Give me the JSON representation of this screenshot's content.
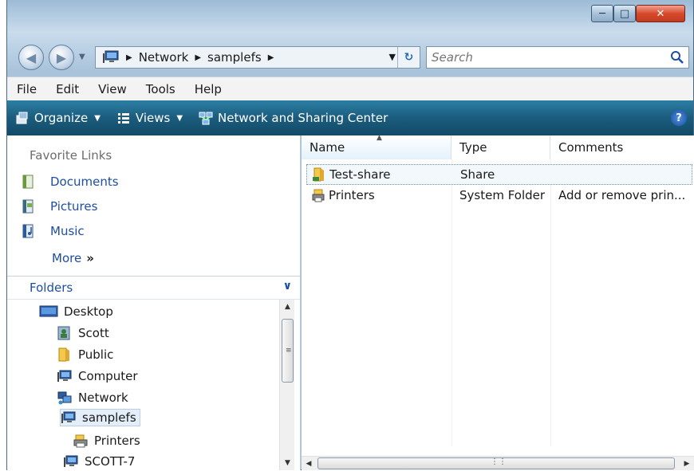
{
  "address": {
    "crumbs": [
      "Network",
      "samplefs"
    ]
  },
  "search": {
    "placeholder": "Search"
  },
  "menubar": [
    "File",
    "Edit",
    "View",
    "Tools",
    "Help"
  ],
  "commandbar": {
    "organize": "Organize",
    "views": "Views",
    "network_center": "Network and Sharing Center"
  },
  "favorites": {
    "title": "Favorite Links",
    "items": [
      "Documents",
      "Pictures",
      "Music"
    ],
    "more": "More",
    "more_glyph": "»"
  },
  "folders": {
    "title": "Folders",
    "tree": [
      "Desktop",
      "Scott",
      "Public",
      "Computer",
      "Network",
      "samplefs",
      "Printers",
      "SCOTT-7"
    ]
  },
  "columns": {
    "name": "Name",
    "type": "Type",
    "comments": "Comments"
  },
  "files": [
    {
      "name": "Test-share",
      "type": "Share",
      "comments": ""
    },
    {
      "name": "Printers",
      "type": "System Folder",
      "comments": "Add or remove prin..."
    }
  ],
  "colors": {
    "accent_link": "#1d4ea3",
    "command_bar": "#1b5c7d",
    "close_button": "#d64b2d"
  }
}
